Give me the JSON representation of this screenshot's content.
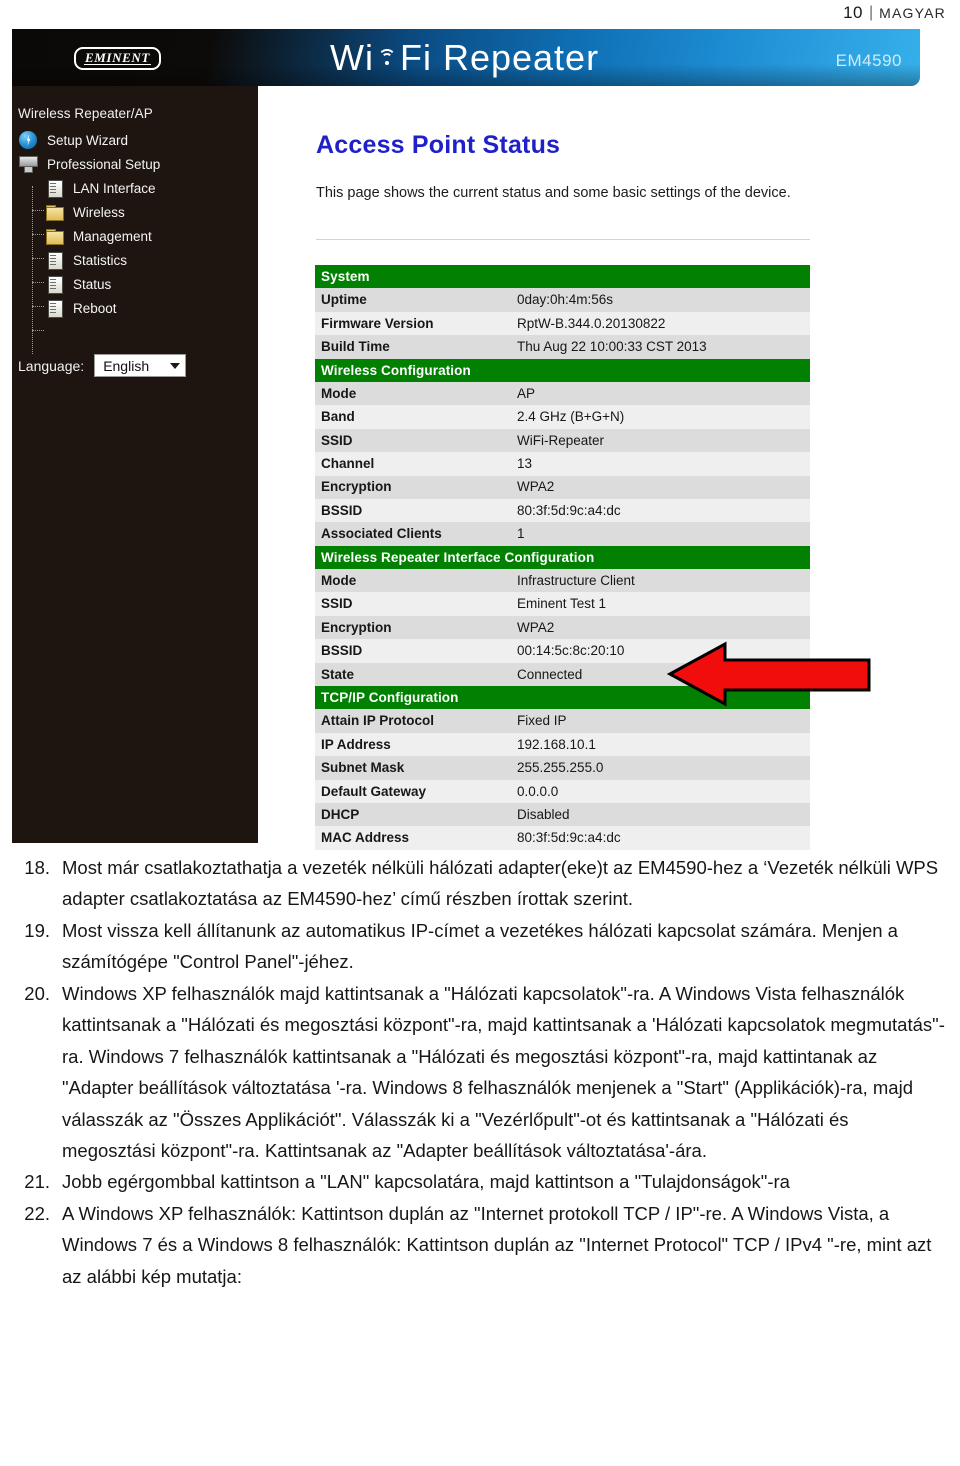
{
  "page_header": {
    "page_number": "10",
    "separator": "|",
    "language": "MAGYAR"
  },
  "router_ui": {
    "banner": {
      "logo": "EMINENT",
      "title_part1": "Wi",
      "title_part2": "Fi Repeater",
      "model": "EM4590",
      "wifi_icon": "wifi-signal-icon"
    },
    "sidebar": {
      "root_label": "Wireless Repeater/AP",
      "items": [
        {
          "label": "Setup Wizard",
          "icon": "wizard-icon",
          "level": 1
        },
        {
          "label": "Professional Setup",
          "icon": "server-icon",
          "level": 1
        },
        {
          "label": "LAN Interface",
          "icon": "document-icon",
          "level": 2
        },
        {
          "label": "Wireless",
          "icon": "folder-icon",
          "level": 2
        },
        {
          "label": "Management",
          "icon": "folder-icon",
          "level": 2
        },
        {
          "label": "Statistics",
          "icon": "document-icon",
          "level": 2
        },
        {
          "label": "Status",
          "icon": "document-icon",
          "level": 2
        },
        {
          "label": "Reboot",
          "icon": "document-icon",
          "level": 2
        }
      ],
      "language_label": "Language:",
      "language_value": "English",
      "language_caret": "chevron-down-icon"
    },
    "content": {
      "title": "Access Point Status",
      "description": "This page shows the current status and some basic settings of the device.",
      "accent_color": "#2020c8",
      "section_color": "#018001",
      "rows": [
        {
          "type": "section",
          "label": "System"
        },
        {
          "type": "data",
          "key": "Uptime",
          "value": "0day:0h:4m:56s"
        },
        {
          "type": "data",
          "key": "Firmware Version",
          "value": "RptW-B.344.0.20130822"
        },
        {
          "type": "data",
          "key": "Build Time",
          "value": "Thu Aug 22 10:00:33 CST 2013"
        },
        {
          "type": "section",
          "label": "Wireless Configuration"
        },
        {
          "type": "data",
          "key": "Mode",
          "value": "AP"
        },
        {
          "type": "data",
          "key": "Band",
          "value": "2.4 GHz (B+G+N)"
        },
        {
          "type": "data",
          "key": "SSID",
          "value": "WiFi-Repeater"
        },
        {
          "type": "data",
          "key": "Channel",
          "value": "13"
        },
        {
          "type": "data",
          "key": "Encryption",
          "value": "WPA2"
        },
        {
          "type": "data",
          "key": "BSSID",
          "value": "80:3f:5d:9c:a4:dc"
        },
        {
          "type": "data",
          "key": "Associated Clients",
          "value": "1"
        },
        {
          "type": "section",
          "label": "Wireless Repeater Interface Configuration"
        },
        {
          "type": "data",
          "key": "Mode",
          "value": "Infrastructure Client"
        },
        {
          "type": "data",
          "key": "SSID",
          "value": "Eminent Test 1"
        },
        {
          "type": "data",
          "key": "Encryption",
          "value": "WPA2"
        },
        {
          "type": "data",
          "key": "BSSID",
          "value": "00:14:5c:8c:20:10"
        },
        {
          "type": "data",
          "key": "State",
          "value": "Connected"
        },
        {
          "type": "section",
          "label": "TCP/IP Configuration"
        },
        {
          "type": "data",
          "key": "Attain IP Protocol",
          "value": "Fixed IP"
        },
        {
          "type": "data",
          "key": "IP Address",
          "value": "192.168.10.1"
        },
        {
          "type": "data",
          "key": "Subnet Mask",
          "value": "255.255.255.0"
        },
        {
          "type": "data",
          "key": "Default Gateway",
          "value": "0.0.0.0"
        },
        {
          "type": "data",
          "key": "DHCP",
          "value": "Disabled"
        },
        {
          "type": "data",
          "key": "MAC Address",
          "value": "80:3f:5d:9c:a4:dc"
        }
      ]
    },
    "annotation": {
      "icon": "red-left-arrow-icon",
      "fill_color": "#f20d0d",
      "stroke_color": "#000000",
      "points_at": "State"
    }
  },
  "instructions": [
    {
      "number": "18.",
      "text": "Most már csatlakoztathatja a vezeték nélküli hálózati adapter(eke)t az EM4590-hez a ‘Vezeték nélküli WPS adapter csatlakoztatása az EM4590-hez’ című részben írottak szerint."
    },
    {
      "number": "19.",
      "text": "Most vissza kell állítanunk az automatikus IP-címet a vezetékes hálózati kapcsolat számára. Menjen a számítógépe \"Control Panel\"-jéhez."
    },
    {
      "number": "20.",
      "text": "Windows XP felhasználók majd kattintsanak  a \"Hálózati kapcsolatok\"-ra. A Windows Vista felhasználók kattintsanak a \"Hálózati és megosztási központ\"-ra, majd kattintsanak a 'Hálózati kapcsolatok megmutatás\"-ra. Windows 7 felhasználók kattintsanak a \"Hálózati és megosztási központ\"-ra, majd kattintanak az \"Adapter beállítások változtatása '-ra. Windows 8 felhasználók menjenek a \"Start\" (Applikációk)-ra, majd válasszák az \"Összes Applikációt\". Válasszák ki a \"Vezérlőpult\"-ot és kattintsanak a \"Hálózati és megosztási központ\"-ra. Kattintsanak az \"Adapter beállítások változtatása'-ára."
    },
    {
      "number": "21.",
      "text": "Jobb egérgombbal kattintson a \"LAN\" kapcsolatára, majd kattintson a \"Tulajdonságok\"-ra"
    },
    {
      "number": "22.",
      "text": "A Windows XP felhasználók: Kattintson duplán az \"Internet protokoll TCP / IP\"-re. A Windows Vista, a Windows 7 és a Windows 8 felhasználók: Kattintson duplán az \"Internet Protocol\" TCP / IPv4 \"-re, mint azt az alábbi kép mutatja:"
    }
  ]
}
